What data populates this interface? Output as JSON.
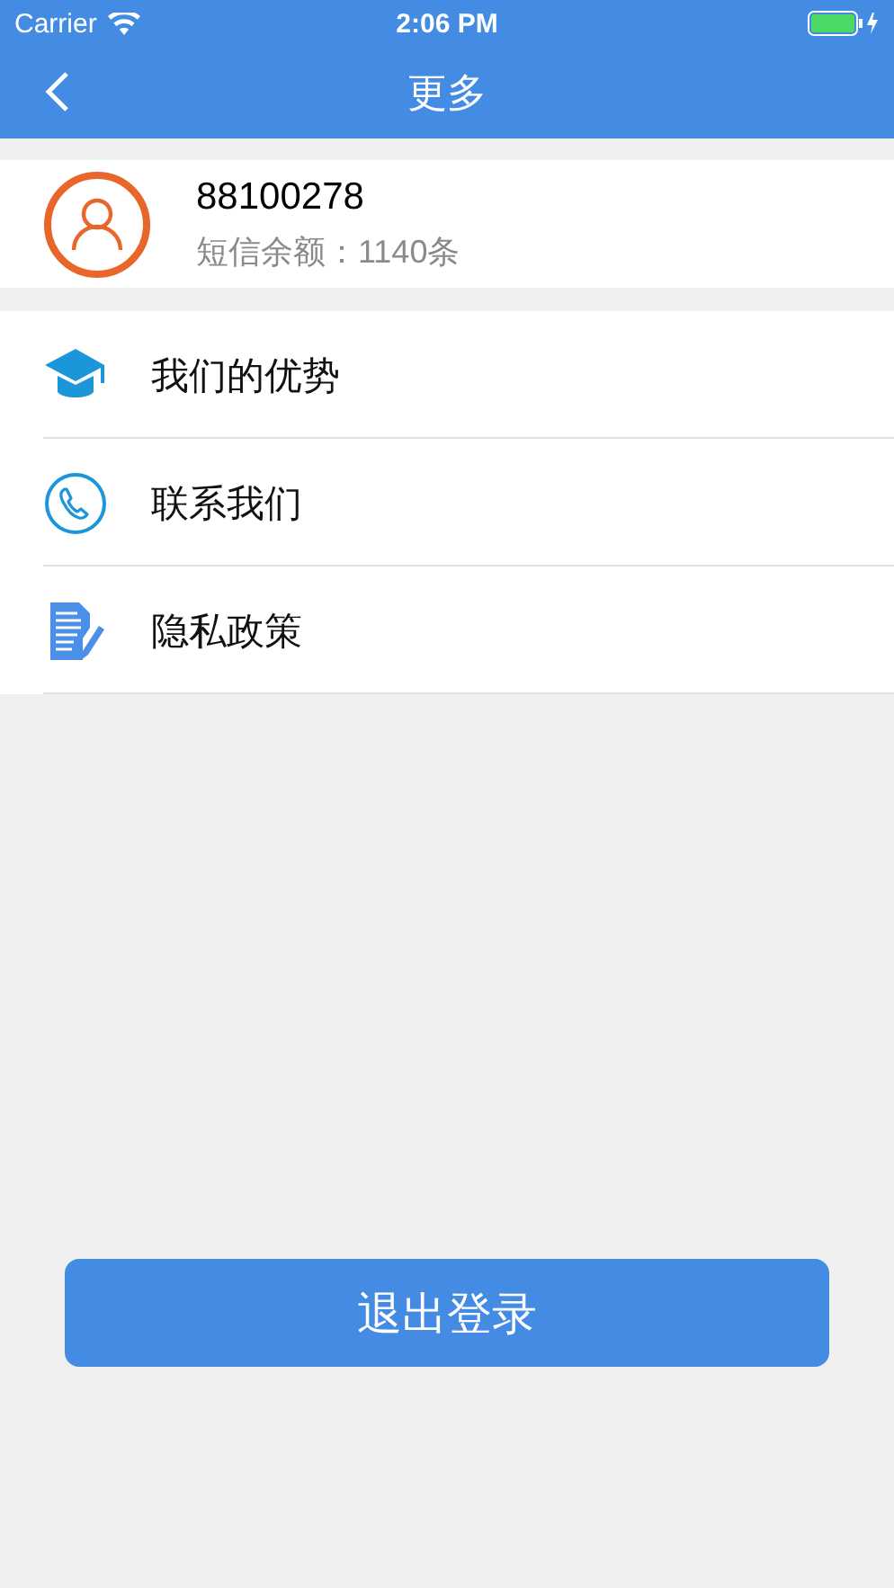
{
  "status_bar": {
    "carrier": "Carrier",
    "time": "2:06 PM"
  },
  "nav": {
    "title": "更多"
  },
  "profile": {
    "account": "88100278",
    "sms_balance": "短信余额：1140条"
  },
  "menu": [
    {
      "kind": "cap",
      "label": "我们的优势"
    },
    {
      "kind": "phone",
      "label": "联系我们"
    },
    {
      "kind": "doc",
      "label": "隐私政策"
    }
  ],
  "logout_button": "退出登录"
}
